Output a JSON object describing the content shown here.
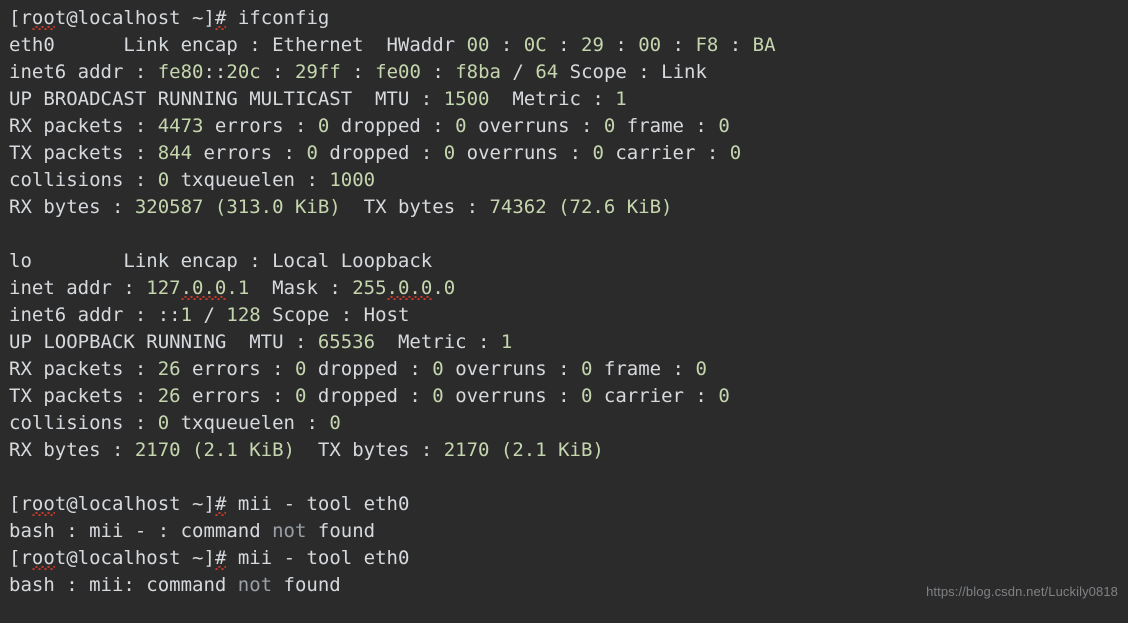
{
  "terminal": {
    "background_color": "#2b2b2b",
    "text_color": "#d6d9dd",
    "number_color": "#c5d6ae",
    "dim_color": "#9aa0a6",
    "squiggle_color": "#c0392b",
    "prompt": "[root@localhost ~]#",
    "watermark": "https://blog.csdn.net/Luckily0818"
  },
  "lines": [
    {
      "id": "cmd-ifconfig",
      "tokens": [
        {
          "text": "[r",
          "style": "plain"
        },
        {
          "text": "oo",
          "style": "plain",
          "squiggle": true
        },
        {
          "text": "t@localhost ~]",
          "style": "plain"
        },
        {
          "text": "#",
          "style": "plain",
          "squiggle": true
        },
        {
          "text": " ifconfig",
          "style": "plain"
        }
      ]
    },
    {
      "id": "eth0-link-encap",
      "tokens": [
        {
          "text": "eth0      Link encap : Ethernet  HWaddr ",
          "style": "plain"
        },
        {
          "text": "00",
          "style": "num"
        },
        {
          "text": " : ",
          "style": "plain"
        },
        {
          "text": "0C",
          "style": "num"
        },
        {
          "text": " : ",
          "style": "plain"
        },
        {
          "text": "29",
          "style": "num"
        },
        {
          "text": " : ",
          "style": "plain"
        },
        {
          "text": "00",
          "style": "num"
        },
        {
          "text": " : ",
          "style": "plain"
        },
        {
          "text": "F8",
          "style": "num"
        },
        {
          "text": " : ",
          "style": "plain"
        },
        {
          "text": "BA",
          "style": "num"
        }
      ]
    },
    {
      "id": "eth0-inet6-addr",
      "tokens": [
        {
          "text": "inet6 addr : ",
          "style": "plain"
        },
        {
          "text": "fe80",
          "style": "num"
        },
        {
          "text": "::",
          "style": "plain"
        },
        {
          "text": "20c",
          "style": "num"
        },
        {
          "text": " : ",
          "style": "plain"
        },
        {
          "text": "29ff",
          "style": "num"
        },
        {
          "text": " : ",
          "style": "plain"
        },
        {
          "text": "fe00",
          "style": "num"
        },
        {
          "text": " : ",
          "style": "plain"
        },
        {
          "text": "f8ba",
          "style": "num"
        },
        {
          "text": " / ",
          "style": "plain"
        },
        {
          "text": "64",
          "style": "num"
        },
        {
          "text": " Scope : Link",
          "style": "plain"
        }
      ]
    },
    {
      "id": "eth0-flags",
      "tokens": [
        {
          "text": "UP BROADCAST RUNNING MULTICAST  MTU : ",
          "style": "plain"
        },
        {
          "text": "1500",
          "style": "num"
        },
        {
          "text": "  Metric : ",
          "style": "plain"
        },
        {
          "text": "1",
          "style": "num"
        }
      ]
    },
    {
      "id": "eth0-rx-packets",
      "tokens": [
        {
          "text": "RX packets : ",
          "style": "plain"
        },
        {
          "text": "4473",
          "style": "num"
        },
        {
          "text": " errors : ",
          "style": "plain"
        },
        {
          "text": "0",
          "style": "num"
        },
        {
          "text": " dropped : ",
          "style": "plain"
        },
        {
          "text": "0",
          "style": "num"
        },
        {
          "text": " overruns : ",
          "style": "plain"
        },
        {
          "text": "0",
          "style": "num"
        },
        {
          "text": " frame : ",
          "style": "plain"
        },
        {
          "text": "0",
          "style": "num"
        }
      ]
    },
    {
      "id": "eth0-tx-packets",
      "tokens": [
        {
          "text": "TX packets : ",
          "style": "plain"
        },
        {
          "text": "844",
          "style": "num"
        },
        {
          "text": " errors : ",
          "style": "plain"
        },
        {
          "text": "0",
          "style": "num"
        },
        {
          "text": " dropped : ",
          "style": "plain"
        },
        {
          "text": "0",
          "style": "num"
        },
        {
          "text": " overruns : ",
          "style": "plain"
        },
        {
          "text": "0",
          "style": "num"
        },
        {
          "text": " carrier : ",
          "style": "plain"
        },
        {
          "text": "0",
          "style": "num"
        }
      ]
    },
    {
      "id": "eth0-collisions",
      "tokens": [
        {
          "text": "collisions : ",
          "style": "plain"
        },
        {
          "text": "0",
          "style": "num"
        },
        {
          "text": " txqueuelen : ",
          "style": "plain"
        },
        {
          "text": "1000",
          "style": "num"
        }
      ]
    },
    {
      "id": "eth0-bytes",
      "tokens": [
        {
          "text": "RX bytes : ",
          "style": "plain"
        },
        {
          "text": "320587 (313.0 KiB)",
          "style": "num"
        },
        {
          "text": "  TX bytes : ",
          "style": "plain"
        },
        {
          "text": "74362 (72.6 KiB)",
          "style": "num"
        }
      ]
    },
    {
      "id": "blank-1",
      "tokens": []
    },
    {
      "id": "lo-link-encap",
      "tokens": [
        {
          "text": "lo        Link encap : Local Loopback",
          "style": "plain"
        }
      ]
    },
    {
      "id": "lo-inet-addr",
      "tokens": [
        {
          "text": "inet addr : ",
          "style": "plain"
        },
        {
          "text": "127",
          "style": "num"
        },
        {
          "text": ".0.0",
          "style": "num",
          "squiggle": true
        },
        {
          "text": ".1",
          "style": "num"
        },
        {
          "text": "  Mask : ",
          "style": "plain"
        },
        {
          "text": "255",
          "style": "num"
        },
        {
          "text": ".0.0",
          "style": "num",
          "squiggle": true
        },
        {
          "text": ".0",
          "style": "num"
        }
      ]
    },
    {
      "id": "lo-inet6-addr",
      "tokens": [
        {
          "text": "inet6 addr : ::",
          "style": "plain"
        },
        {
          "text": "1",
          "style": "num"
        },
        {
          "text": " / ",
          "style": "plain"
        },
        {
          "text": "128",
          "style": "num"
        },
        {
          "text": " Scope : Host",
          "style": "plain"
        }
      ]
    },
    {
      "id": "lo-flags",
      "tokens": [
        {
          "text": "UP LOOPBACK RUNNING  MTU : ",
          "style": "plain"
        },
        {
          "text": "65536",
          "style": "num"
        },
        {
          "text": "  Metric : ",
          "style": "plain"
        },
        {
          "text": "1",
          "style": "num"
        }
      ]
    },
    {
      "id": "lo-rx-packets",
      "tokens": [
        {
          "text": "RX packets : ",
          "style": "plain"
        },
        {
          "text": "26",
          "style": "num"
        },
        {
          "text": " errors : ",
          "style": "plain"
        },
        {
          "text": "0",
          "style": "num"
        },
        {
          "text": " dropped : ",
          "style": "plain"
        },
        {
          "text": "0",
          "style": "num"
        },
        {
          "text": " overruns : ",
          "style": "plain"
        },
        {
          "text": "0",
          "style": "num"
        },
        {
          "text": " frame : ",
          "style": "plain"
        },
        {
          "text": "0",
          "style": "num"
        }
      ]
    },
    {
      "id": "lo-tx-packets",
      "tokens": [
        {
          "text": "TX packets : ",
          "style": "plain"
        },
        {
          "text": "26",
          "style": "num"
        },
        {
          "text": " errors : ",
          "style": "plain"
        },
        {
          "text": "0",
          "style": "num"
        },
        {
          "text": " dropped : ",
          "style": "plain"
        },
        {
          "text": "0",
          "style": "num"
        },
        {
          "text": " overruns : ",
          "style": "plain"
        },
        {
          "text": "0",
          "style": "num"
        },
        {
          "text": " carrier : ",
          "style": "plain"
        },
        {
          "text": "0",
          "style": "num"
        }
      ]
    },
    {
      "id": "lo-collisions",
      "tokens": [
        {
          "text": "collisions : ",
          "style": "plain"
        },
        {
          "text": "0",
          "style": "num"
        },
        {
          "text": " txqueuelen : ",
          "style": "plain"
        },
        {
          "text": "0",
          "style": "num"
        }
      ]
    },
    {
      "id": "lo-bytes",
      "tokens": [
        {
          "text": "RX bytes : ",
          "style": "plain"
        },
        {
          "text": "2170 (2.1 KiB)",
          "style": "num"
        },
        {
          "text": "  TX bytes : ",
          "style": "plain"
        },
        {
          "text": "2170 (2.1 KiB)",
          "style": "num"
        }
      ]
    },
    {
      "id": "blank-2",
      "tokens": []
    },
    {
      "id": "cmd-mii-tool-1",
      "tokens": [
        {
          "text": "[r",
          "style": "plain"
        },
        {
          "text": "oo",
          "style": "plain",
          "squiggle": true
        },
        {
          "text": "t@localhost ~]",
          "style": "plain"
        },
        {
          "text": "#",
          "style": "plain",
          "squiggle": true
        },
        {
          "text": " mii - tool eth0",
          "style": "plain"
        }
      ]
    },
    {
      "id": "err-mii-tool-1",
      "tokens": [
        {
          "text": "bash : mii - : command ",
          "style": "plain"
        },
        {
          "text": "not",
          "style": "dim"
        },
        {
          "text": " found",
          "style": "plain"
        }
      ]
    },
    {
      "id": "cmd-mii-tool-2",
      "tokens": [
        {
          "text": "[r",
          "style": "plain"
        },
        {
          "text": "oo",
          "style": "plain",
          "squiggle": true
        },
        {
          "text": "t@localhost ~]",
          "style": "plain"
        },
        {
          "text": "#",
          "style": "plain",
          "squiggle": true
        },
        {
          "text": " mii - tool eth0",
          "style": "plain"
        }
      ]
    },
    {
      "id": "err-mii-tool-2",
      "tokens": [
        {
          "text": "bash : mii: command ",
          "style": "plain"
        },
        {
          "text": "not",
          "style": "dim"
        },
        {
          "text": " found",
          "style": "plain"
        }
      ]
    }
  ]
}
